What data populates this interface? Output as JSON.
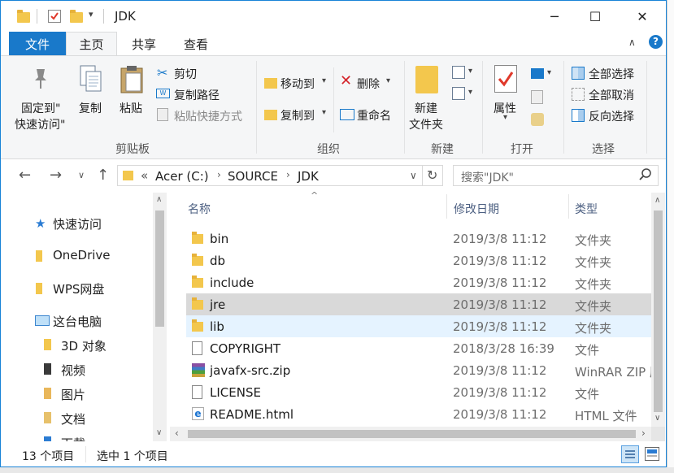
{
  "window": {
    "title": "JDK",
    "controls": {
      "minimize": "─",
      "maximize": "☐",
      "close": "✕"
    }
  },
  "ribbon_tabs": {
    "file": "文件",
    "home": "主页",
    "share": "共享",
    "view": "查看"
  },
  "ribbon": {
    "clipboard": {
      "label": "剪贴板",
      "pin_line1": "固定到\"",
      "pin_line2": "快速访问\"",
      "copy": "复制",
      "paste": "粘贴",
      "cut": "剪切",
      "copy_path": "复制路径",
      "paste_shortcut": "粘贴快捷方式"
    },
    "organize": {
      "label": "组织",
      "move_to": "移动到",
      "copy_to": "复制到",
      "delete": "删除",
      "rename": "重命名"
    },
    "new": {
      "label": "新建",
      "new_folder_line1": "新建",
      "new_folder_line2": "文件夹"
    },
    "open": {
      "label": "打开",
      "properties": "属性"
    },
    "select": {
      "label": "选择",
      "select_all": "全部选择",
      "select_none": "全部取消",
      "invert": "反向选择"
    }
  },
  "address": {
    "overflow": "«",
    "crumbs": [
      "Acer (C:)",
      "SOURCE",
      "JDK"
    ],
    "search_placeholder": "搜索\"JDK\""
  },
  "nav": {
    "quick_access": "快速访问",
    "onedrive": "OneDrive",
    "wps": "WPS网盘",
    "this_pc": "这台电脑",
    "objects3d": "3D 对象",
    "videos": "视频",
    "pictures": "图片",
    "documents": "文档",
    "downloads": "下载"
  },
  "columns": {
    "name": "名称",
    "date": "修改日期",
    "type": "类型"
  },
  "files": [
    {
      "name": "bin",
      "date": "2019/3/8 11:12",
      "type": "文件夹",
      "icon": "folder-icon"
    },
    {
      "name": "db",
      "date": "2019/3/8 11:12",
      "type": "文件夹",
      "icon": "folder-icon"
    },
    {
      "name": "include",
      "date": "2019/3/8 11:12",
      "type": "文件夹",
      "icon": "folder-icon"
    },
    {
      "name": "jre",
      "date": "2019/3/8 11:12",
      "type": "文件夹",
      "icon": "folder-icon"
    },
    {
      "name": "lib",
      "date": "2019/3/8 11:12",
      "type": "文件夹",
      "icon": "folder-icon"
    },
    {
      "name": "COPYRIGHT",
      "date": "2018/3/28 16:39",
      "type": "文件",
      "icon": "document-icon"
    },
    {
      "name": "javafx-src.zip",
      "date": "2019/3/8 11:12",
      "type": "WinRAR ZIP 压缩文件",
      "icon": "winrar-icon"
    },
    {
      "name": "LICENSE",
      "date": "2019/3/8 11:12",
      "type": "文件",
      "icon": "document-icon"
    },
    {
      "name": "README.html",
      "date": "2019/3/8 11:12",
      "type": "HTML 文件",
      "icon": "html-icon"
    }
  ],
  "status": {
    "count": "13 个项目",
    "selected": "选中 1 个项目"
  }
}
